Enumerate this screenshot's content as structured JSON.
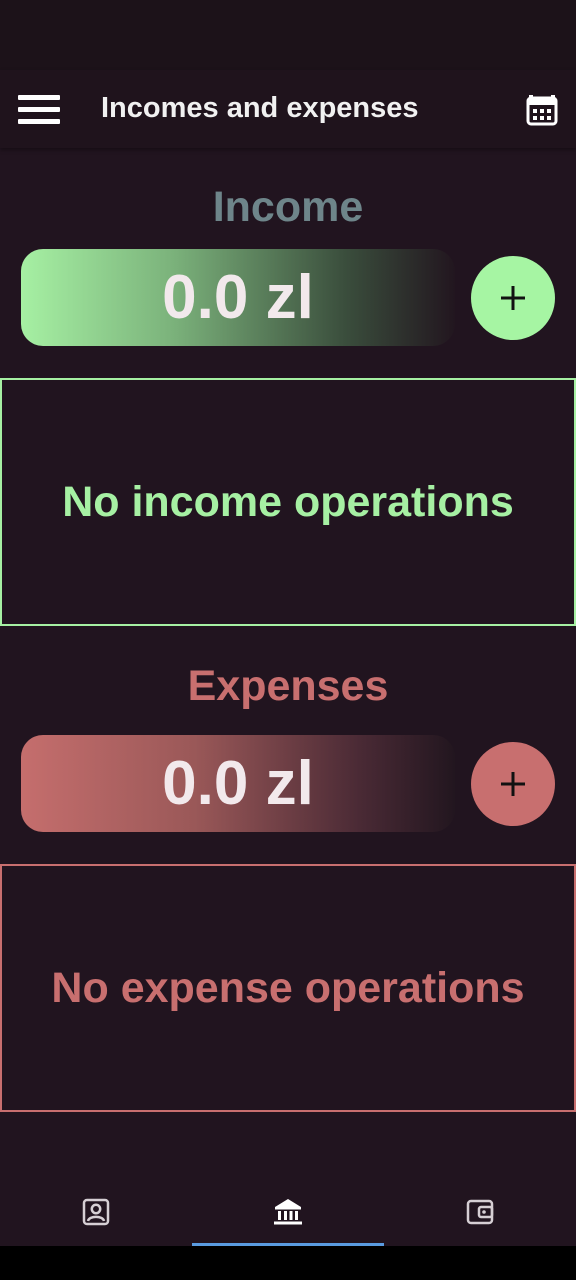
{
  "app_bar": {
    "title": "Incomes and expenses",
    "menu_icon": "hamburger-menu-icon",
    "calendar_icon": "calendar-icon"
  },
  "income": {
    "title": "Income",
    "total": "0.0 zl",
    "empty_text": "No income operations",
    "add_icon": "plus-icon",
    "color": "#a6f0a3"
  },
  "expenses": {
    "title": "Expenses",
    "total": "0.0 zl",
    "empty_text": "No expense operations",
    "add_icon": "plus-icon",
    "color": "#c86f6f"
  },
  "bottom_nav": {
    "items": [
      {
        "icon": "account-box-icon",
        "selected": false
      },
      {
        "icon": "bank-icon",
        "selected": true
      },
      {
        "icon": "wallet-icon",
        "selected": false
      }
    ],
    "indicator_color": "#5a9be0"
  },
  "colors": {
    "background": "#21141f",
    "income_accent": "#a6f0a3",
    "expense_accent": "#c86f6f",
    "income_title": "#6e858a"
  }
}
